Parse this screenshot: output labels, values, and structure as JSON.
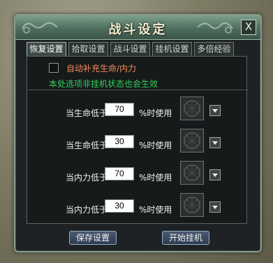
{
  "dialog": {
    "title": "战斗设定",
    "close_label": "X"
  },
  "tabs": [
    {
      "label": "恢复设置",
      "active": true
    },
    {
      "label": "拾取设置",
      "active": false
    },
    {
      "label": "战斗设置",
      "active": false
    },
    {
      "label": "挂机设置",
      "active": false
    },
    {
      "label": "多倍经验",
      "active": false
    }
  ],
  "recovery": {
    "auto_refill_label": "自动补充生命/内力",
    "auto_refill_checked": false,
    "note": "本处选项非挂机状态也会生效",
    "rows": [
      {
        "label": "当生命低于",
        "value": "70",
        "suffix": "%时使用"
      },
      {
        "label": "当生命低于",
        "value": "30",
        "suffix": "%时使用"
      },
      {
        "label": "当内力低于",
        "value": "70",
        "suffix": "%时使用"
      },
      {
        "label": "当内力低于",
        "value": "30",
        "suffix": "%时使用"
      }
    ]
  },
  "buttons": {
    "save": "保存设置",
    "start": "开始挂机"
  },
  "colors": {
    "accent_note": "#34d05a",
    "checkbox_label": "#f08a5a"
  }
}
